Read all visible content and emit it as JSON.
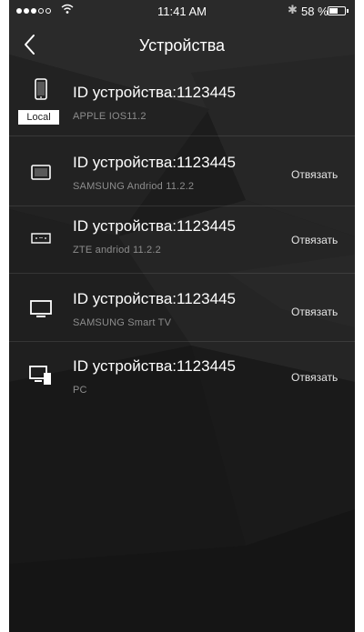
{
  "status_bar": {
    "time": "11:41 AM",
    "battery_percent": "58 %",
    "battery_level": 0.58,
    "bluetooth_icon": "bluetooth-icon",
    "wifi_icon": "wifi-icon"
  },
  "nav": {
    "title": "Устройства",
    "back_icon": "chevron-left-icon"
  },
  "devices": [
    {
      "id_text": "ID устройства:1123445",
      "subtitle": "APPLE  IOS11.2",
      "icon": "phone-icon",
      "badge": "Local"
    },
    {
      "id_text": "ID устройства:1123445",
      "subtitle": "SAMSUNG   Andriod 11.2.2",
      "icon": "tablet-icon",
      "action": "Отвязать"
    },
    {
      "id_text": "ID устройства:1123445",
      "subtitle": "ZTE   andriod 11.2.2",
      "icon": "box-icon",
      "action": "Отвязать"
    },
    {
      "id_text": "ID устройства:1123445",
      "subtitle": "SAMSUNG Smart TV",
      "icon": "tv-icon",
      "action": "Отвязать"
    },
    {
      "id_text": "ID устройства:1123445",
      "subtitle": "PC",
      "icon": "pc-icon",
      "action": "Отвязать"
    }
  ],
  "colors": {
    "background": "#1e1e1e",
    "text": "#ffffff",
    "subtext": "#8d8d8d"
  }
}
